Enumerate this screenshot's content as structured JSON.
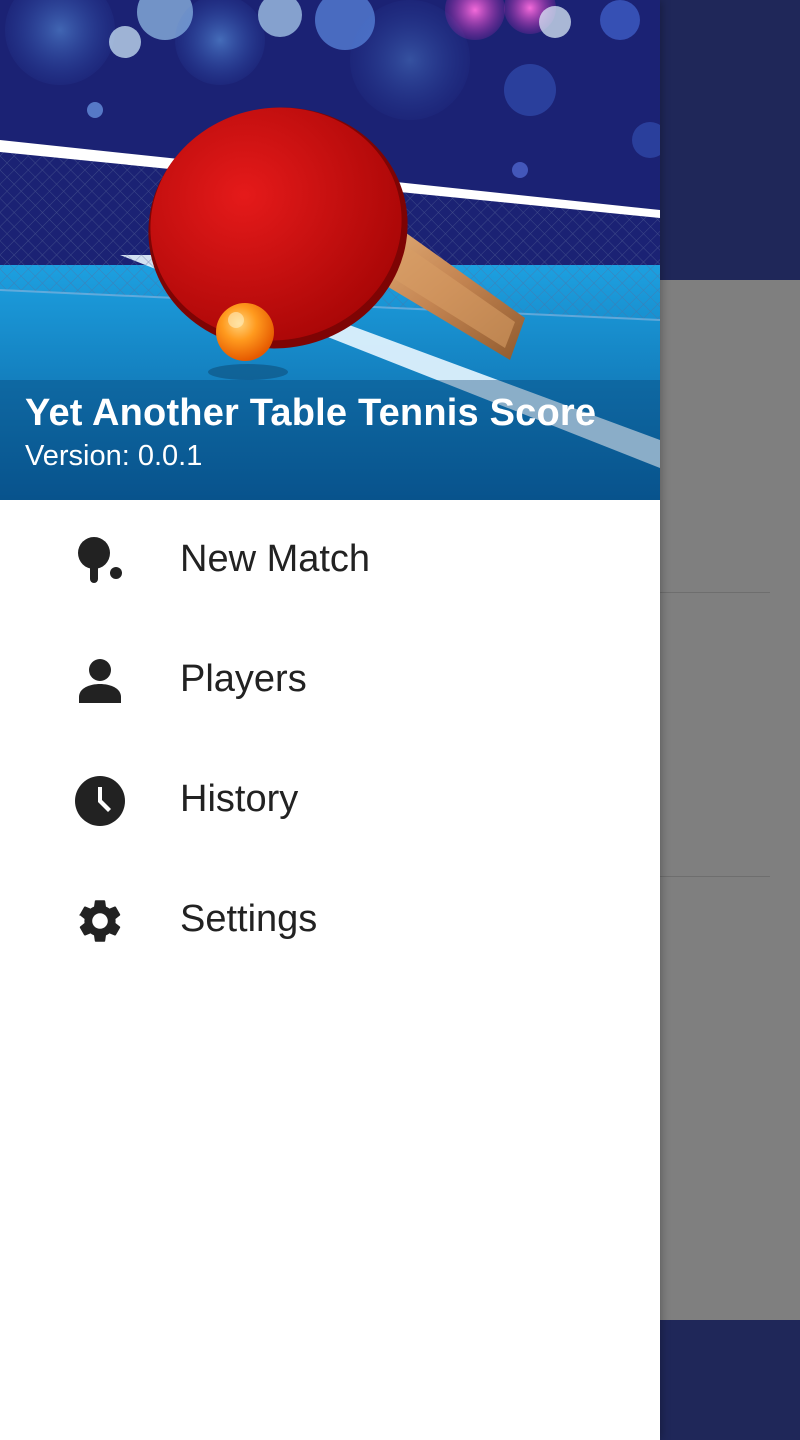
{
  "app": {
    "title": "Yet Another Table Tennis Score",
    "version": "Version: 0.0.1"
  },
  "colors": {
    "appbar": "#1f2759",
    "scrim": "#7f7f7f",
    "drawer_background": "#ffffff",
    "icon": "#222222",
    "text": "#222222"
  },
  "drawer": {
    "items": [
      {
        "label": "New Match",
        "icon": "paddle-ball-icon"
      },
      {
        "label": "Players",
        "icon": "person-icon"
      },
      {
        "label": "History",
        "icon": "clock-icon"
      },
      {
        "label": "Settings",
        "icon": "gear-icon"
      }
    ]
  }
}
